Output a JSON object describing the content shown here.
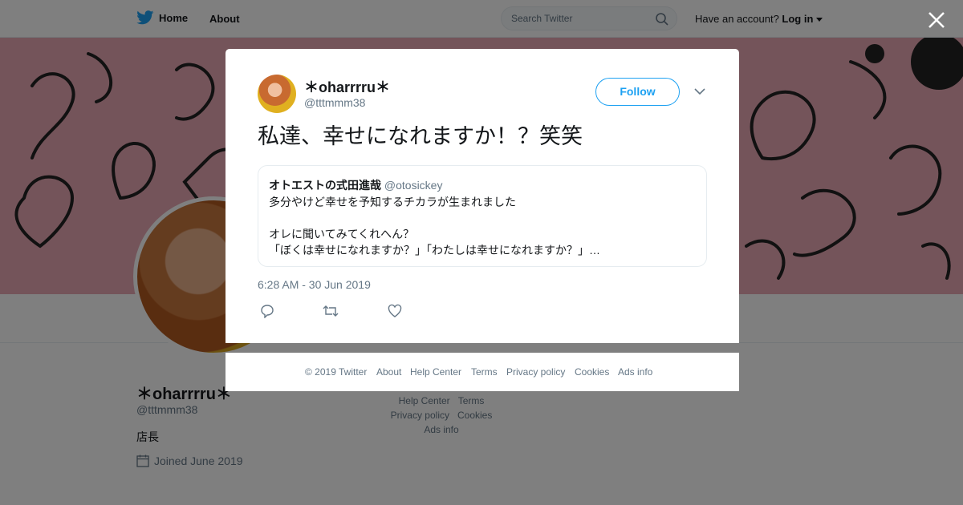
{
  "nav": {
    "home_label": "Home",
    "about_label": "About",
    "search_placeholder": "Search Twitter",
    "account_prompt": "Have an account?",
    "login_label": "Log in"
  },
  "profile": {
    "name": "＊oharrrru＊",
    "handle": "@tttmmm38",
    "bio": "店長",
    "joined": "Joined June 2019"
  },
  "side_footer": {
    "help_center": "Help Center",
    "terms": "Terms",
    "privacy": "Privacy policy",
    "cookies": "Cookies",
    "ads_info": "Ads info"
  },
  "tweet": {
    "name": "＊oharrrru＊",
    "handle": "@tttmmm38",
    "follow_label": "Follow",
    "text": "私達、幸せになれますか！？笑笑",
    "timestamp": "6:28 AM - 30 Jun 2019",
    "quote": {
      "name": "オトエストの式田進哉",
      "handle": "@otosickey",
      "line1": "多分やけど幸せを予知するチカラが生まれました",
      "line2": "オレに聞いてみてくれへん？",
      "line3": "「ぼくは幸せになれますか？」「わたしは幸せになれますか？」…"
    }
  },
  "modal_footer": {
    "copyright": "© 2019 Twitter",
    "about": "About",
    "help_center": "Help Center",
    "terms": "Terms",
    "privacy": "Privacy policy",
    "cookies": "Cookies",
    "ads_info": "Ads info"
  },
  "colors": {
    "accent": "#1da1f2",
    "secondary_text": "#657786",
    "banner": "#e9a8b4"
  },
  "icons": [
    "twitter-bird-icon",
    "search-icon",
    "caret-down-icon",
    "close-icon",
    "chevron-down-icon",
    "reply-icon",
    "retweet-icon",
    "like-icon",
    "calendar-icon"
  ]
}
